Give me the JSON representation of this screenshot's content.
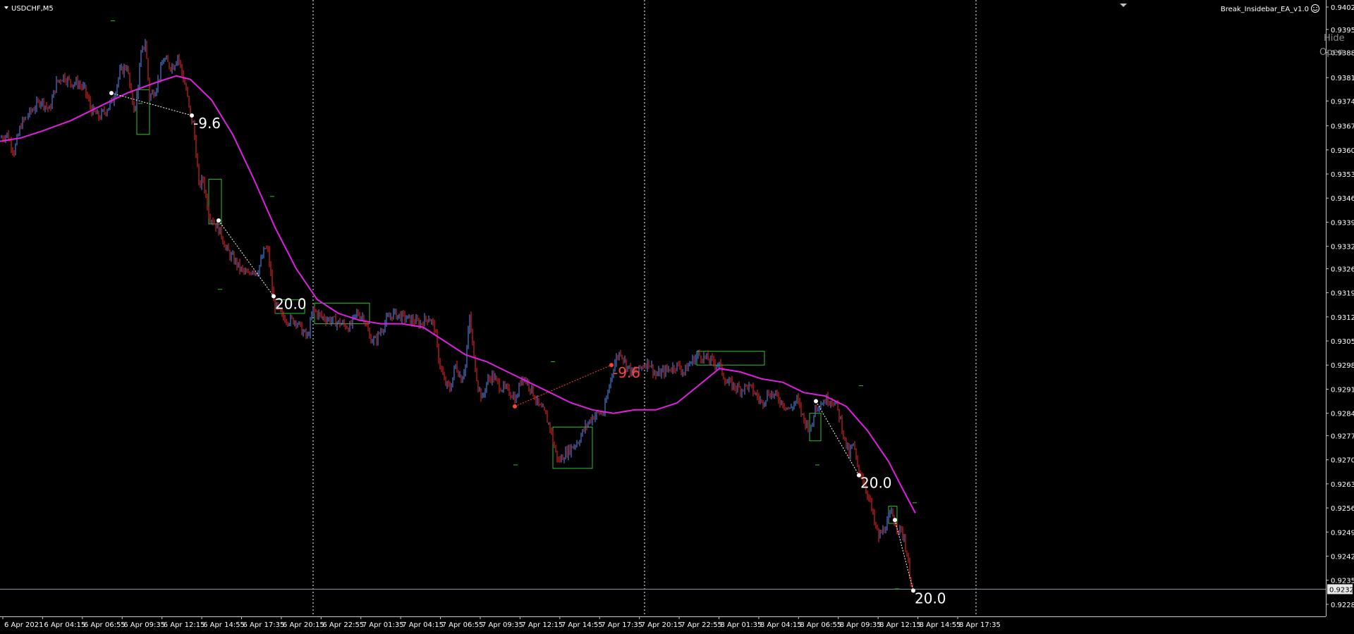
{
  "window": {
    "symbol_title": "USDCHF,M5",
    "ea_label": "Break_Insidebar_EA_v1.0"
  },
  "buttons": {
    "hide_label": "Hide",
    "open_label": "Open"
  },
  "colors": {
    "background": "#000000",
    "bull": "#4a7ad4",
    "bear": "#d42020",
    "ma": "#e020e0",
    "box": "#2fc12f",
    "grid": "#ffffff",
    "win_text": "#ffffff",
    "loss_text": "#ff4040"
  },
  "chart_data": {
    "type": "candlestick",
    "title": "USDCHF,M5",
    "ylim": [
      0.9225,
      0.9402
    ],
    "y_ticks": [
      "0.94020",
      "0.93955",
      "0.93888",
      "0.93815",
      "0.93747",
      "0.93675",
      "0.93605",
      "0.93535",
      "0.93465",
      "0.93395",
      "0.93325",
      "0.93260",
      "0.93190",
      "0.93120",
      "0.93050",
      "0.92980",
      "0.92910",
      "0.92840",
      "0.92775",
      "0.92705",
      "0.92635",
      "0.92565",
      "0.92495",
      "0.92425",
      "0.92355",
      "0.92285"
    ],
    "x_ticks": [
      "6 Apr 2021",
      "6 Apr 04:15",
      "6 Apr 06:55",
      "6 Apr 09:35",
      "6 Apr 12:15",
      "6 Apr 14:55",
      "6 Apr 17:35",
      "6 Apr 20:15",
      "6 Apr 22:55",
      "7 Apr 01:35",
      "7 Apr 04:15",
      "7 Apr 06:55",
      "7 Apr 09:35",
      "7 Apr 12:15",
      "7 Apr 14:55",
      "7 Apr 17:35",
      "7 Apr 20:15",
      "7 Apr 22:55",
      "8 Apr 01:35",
      "8 Apr 04:15",
      "8 Apr 06:55",
      "8 Apr 09:35",
      "8 Apr 12:15",
      "8 Apr 14:55",
      "8 Apr 17:35"
    ],
    "current_price": "0.92329",
    "price_path": [
      [
        0,
        0.9364
      ],
      [
        10,
        0.9365
      ],
      [
        20,
        0.936
      ],
      [
        30,
        0.9368
      ],
      [
        45,
        0.9372
      ],
      [
        58,
        0.9375
      ],
      [
        70,
        0.9372
      ],
      [
        80,
        0.938
      ],
      [
        90,
        0.9382
      ],
      [
        100,
        0.938
      ],
      [
        110,
        0.938
      ],
      [
        120,
        0.9378
      ],
      [
        130,
        0.9372
      ],
      [
        140,
        0.937
      ],
      [
        150,
        0.9372
      ],
      [
        160,
        0.9375
      ],
      [
        170,
        0.9383
      ],
      [
        180,
        0.9385
      ],
      [
        186,
        0.9376
      ],
      [
        192,
        0.9372
      ],
      [
        200,
        0.9388
      ],
      [
        206,
        0.9392
      ],
      [
        212,
        0.9376
      ],
      [
        220,
        0.9378
      ],
      [
        226,
        0.9382
      ],
      [
        232,
        0.9387
      ],
      [
        240,
        0.9385
      ],
      [
        246,
        0.9385
      ],
      [
        252,
        0.9388
      ],
      [
        258,
        0.9383
      ],
      [
        264,
        0.9378
      ],
      [
        270,
        0.937
      ],
      [
        274,
        0.9368
      ],
      [
        278,
        0.936
      ],
      [
        282,
        0.935
      ],
      [
        288,
        0.9352
      ],
      [
        296,
        0.9342
      ],
      [
        302,
        0.934
      ],
      [
        308,
        0.9338
      ],
      [
        314,
        0.9336
      ],
      [
        320,
        0.9332
      ],
      [
        326,
        0.933
      ],
      [
        334,
        0.9328
      ],
      [
        340,
        0.9326
      ],
      [
        346,
        0.9325
      ],
      [
        352,
        0.9324
      ],
      [
        358,
        0.9326
      ],
      [
        364,
        0.9325
      ],
      [
        370,
        0.9328
      ],
      [
        376,
        0.9332
      ],
      [
        380,
        0.9331
      ],
      [
        384,
        0.9324
      ],
      [
        388,
        0.9316
      ],
      [
        394,
        0.9314
      ],
      [
        400,
        0.9312
      ],
      [
        410,
        0.9311
      ],
      [
        420,
        0.9311
      ],
      [
        428,
        0.9308
      ],
      [
        436,
        0.9306
      ],
      [
        444,
        0.9314
      ],
      [
        456,
        0.9312
      ],
      [
        470,
        0.9311
      ],
      [
        484,
        0.931
      ],
      [
        496,
        0.9309
      ],
      [
        506,
        0.9313
      ],
      [
        516,
        0.9312
      ],
      [
        524,
        0.9306
      ],
      [
        532,
        0.9305
      ],
      [
        540,
        0.9308
      ],
      [
        548,
        0.9311
      ],
      [
        558,
        0.9313
      ],
      [
        570,
        0.9312
      ],
      [
        584,
        0.9311
      ],
      [
        596,
        0.931
      ],
      [
        608,
        0.9312
      ],
      [
        616,
        0.9309
      ],
      [
        622,
        0.93
      ],
      [
        630,
        0.9293
      ],
      [
        638,
        0.9291
      ],
      [
        646,
        0.9298
      ],
      [
        654,
        0.9294
      ],
      [
        660,
        0.9298
      ],
      [
        666,
        0.9312
      ],
      [
        672,
        0.93
      ],
      [
        678,
        0.9292
      ],
      [
        684,
        0.9288
      ],
      [
        690,
        0.9293
      ],
      [
        698,
        0.9295
      ],
      [
        708,
        0.9292
      ],
      [
        716,
        0.9291
      ],
      [
        724,
        0.929
      ],
      [
        732,
        0.9288
      ],
      [
        740,
        0.9295
      ],
      [
        748,
        0.9293
      ],
      [
        756,
        0.929
      ],
      [
        764,
        0.9286
      ],
      [
        772,
        0.9284
      ],
      [
        780,
        0.928
      ],
      [
        786,
        0.9274
      ],
      [
        792,
        0.927
      ],
      [
        800,
        0.9272
      ],
      [
        810,
        0.9274
      ],
      [
        820,
        0.9276
      ],
      [
        830,
        0.928
      ],
      [
        840,
        0.9283
      ],
      [
        848,
        0.9284
      ],
      [
        856,
        0.9284
      ],
      [
        862,
        0.929
      ],
      [
        868,
        0.9296
      ],
      [
        874,
        0.93
      ],
      [
        880,
        0.9302
      ],
      [
        888,
        0.9298
      ],
      [
        896,
        0.9296
      ],
      [
        904,
        0.9296
      ],
      [
        912,
        0.9298
      ],
      [
        920,
        0.9299
      ],
      [
        930,
        0.9295
      ],
      [
        940,
        0.9296
      ],
      [
        950,
        0.9297
      ],
      [
        960,
        0.9298
      ],
      [
        970,
        0.9296
      ],
      [
        980,
        0.9299
      ],
      [
        990,
        0.9301
      ],
      [
        1000,
        0.93
      ],
      [
        1010,
        0.9299
      ],
      [
        1020,
        0.9298
      ],
      [
        1030,
        0.9293
      ],
      [
        1040,
        0.9292
      ],
      [
        1050,
        0.9291
      ],
      [
        1060,
        0.9292
      ],
      [
        1070,
        0.929
      ],
      [
        1080,
        0.9287
      ],
      [
        1090,
        0.929
      ],
      [
        1100,
        0.9289
      ],
      [
        1110,
        0.9287
      ],
      [
        1120,
        0.9285
      ],
      [
        1130,
        0.9288
      ],
      [
        1140,
        0.9282
      ],
      [
        1150,
        0.9279
      ],
      [
        1156,
        0.9286
      ],
      [
        1164,
        0.9287
      ],
      [
        1172,
        0.9288
      ],
      [
        1180,
        0.9288
      ],
      [
        1186,
        0.9286
      ],
      [
        1192,
        0.9282
      ],
      [
        1198,
        0.9276
      ],
      [
        1204,
        0.9272
      ],
      [
        1210,
        0.9275
      ],
      [
        1216,
        0.9268
      ],
      [
        1222,
        0.9266
      ],
      [
        1228,
        0.9262
      ],
      [
        1234,
        0.9258
      ],
      [
        1240,
        0.9252
      ],
      [
        1246,
        0.9248
      ],
      [
        1252,
        0.925
      ],
      [
        1258,
        0.9252
      ],
      [
        1264,
        0.9255
      ],
      [
        1270,
        0.9252
      ],
      [
        1276,
        0.925
      ],
      [
        1282,
        0.9248
      ],
      [
        1288,
        0.924
      ],
      [
        1294,
        0.9233
      ]
    ],
    "ma_path": [
      [
        0,
        0.9363
      ],
      [
        30,
        0.9364
      ],
      [
        60,
        0.9366
      ],
      [
        100,
        0.9369
      ],
      [
        140,
        0.9373
      ],
      [
        180,
        0.9377
      ],
      [
        220,
        0.938
      ],
      [
        250,
        0.9382
      ],
      [
        270,
        0.9381
      ],
      [
        300,
        0.9375
      ],
      [
        330,
        0.9365
      ],
      [
        360,
        0.9352
      ],
      [
        390,
        0.9338
      ],
      [
        420,
        0.9326
      ],
      [
        450,
        0.9317
      ],
      [
        480,
        0.9313
      ],
      [
        510,
        0.9311
      ],
      [
        540,
        0.931
      ],
      [
        570,
        0.931
      ],
      [
        600,
        0.9309
      ],
      [
        630,
        0.9305
      ],
      [
        660,
        0.9301
      ],
      [
        690,
        0.9299
      ],
      [
        720,
        0.9296
      ],
      [
        750,
        0.9293
      ],
      [
        780,
        0.929
      ],
      [
        810,
        0.9287
      ],
      [
        840,
        0.9285
      ],
      [
        870,
        0.9284
      ],
      [
        900,
        0.9285
      ],
      [
        930,
        0.9285
      ],
      [
        960,
        0.9287
      ],
      [
        990,
        0.9292
      ],
      [
        1020,
        0.9297
      ],
      [
        1050,
        0.9296
      ],
      [
        1080,
        0.9294
      ],
      [
        1110,
        0.9293
      ],
      [
        1140,
        0.929
      ],
      [
        1170,
        0.9289
      ],
      [
        1200,
        0.9286
      ],
      [
        1230,
        0.9279
      ],
      [
        1260,
        0.927
      ],
      [
        1280,
        0.9262
      ],
      [
        1298,
        0.9255
      ]
    ],
    "boxes": [
      [
        194,
        212,
        0.9378,
        0.9365
      ],
      [
        296,
        314,
        0.9352,
        0.9339
      ],
      [
        390,
        432,
        0.9317,
        0.9313
      ],
      [
        446,
        524,
        0.9316,
        0.931
      ],
      [
        784,
        840,
        0.928,
        0.9268
      ],
      [
        988,
        1084,
        0.9302,
        0.9298
      ],
      [
        1148,
        1164,
        0.9284,
        0.9276
      ],
      [
        1260,
        1272,
        0.9257,
        0.9252
      ]
    ],
    "trades": [
      {
        "x1": 158,
        "y1": 0.9377,
        "x2": 272,
        "y2": 0.93705,
        "result": "-9.6",
        "win": true
      },
      {
        "x1": 310,
        "y1": 0.934,
        "x2": 388,
        "y2": 0.9318,
        "result": "20.0",
        "win": true
      },
      {
        "x1": 730,
        "y1": 0.9286,
        "x2": 867,
        "y2": 0.9298,
        "result": "-9.6",
        "win": false
      },
      {
        "x1": 1157,
        "y1": 0.92875,
        "x2": 1218,
        "y2": 0.9266,
        "result": "20.0",
        "win": true
      },
      {
        "x1": 1269,
        "y1": 0.9253,
        "x2": 1295,
        "y2": 0.92325,
        "result": "20.0",
        "win": true
      }
    ],
    "separators_x": [
      444,
      914,
      1384
    ],
    "dash_markers": [
      [
        160,
        0.9398
      ],
      [
        199,
        0.9374
      ],
      [
        386,
        0.9347
      ],
      [
        312,
        0.932
      ],
      [
        731,
        0.9269
      ],
      [
        784,
        0.9299
      ],
      [
        1159,
        0.9269
      ],
      [
        1221,
        0.9292
      ],
      [
        1297,
        0.9258
      ],
      [
        1272,
        0.9233
      ]
    ]
  }
}
